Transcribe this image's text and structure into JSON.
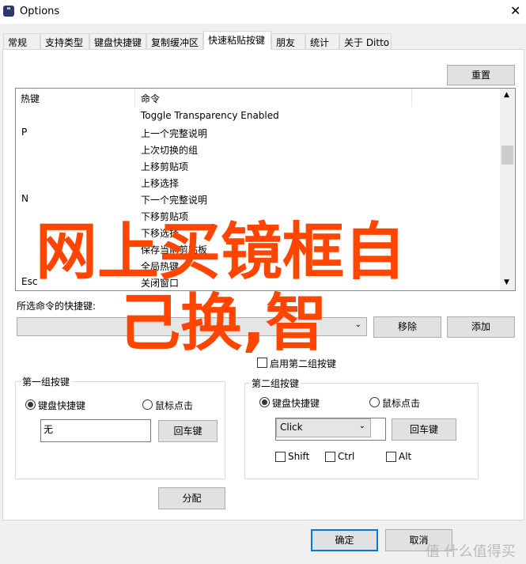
{
  "window": {
    "title": "Options",
    "close": "✕",
    "icon": "ditto-app-icon"
  },
  "tabs": [
    {
      "label": "常规"
    },
    {
      "label": "支持类型"
    },
    {
      "label": "键盘快捷键"
    },
    {
      "label": "复制缓冲区"
    },
    {
      "label": "快速粘贴按键",
      "active": true
    },
    {
      "label": "朋友"
    },
    {
      "label": "统计"
    },
    {
      "label": "关于 Ditto"
    }
  ],
  "reset_label": "重置",
  "list": {
    "headers": [
      "热键",
      "命令"
    ],
    "rows": [
      {
        "key": "",
        "cmd": "Toggle Transparency Enabled"
      },
      {
        "key": "P",
        "cmd": "上一个完整说明"
      },
      {
        "key": "",
        "cmd": "上次切换的组"
      },
      {
        "key": "",
        "cmd": "上移剪贴项"
      },
      {
        "key": "",
        "cmd": "上移选择"
      },
      {
        "key": "N",
        "cmd": "下一个完整说明"
      },
      {
        "key": "",
        "cmd": "下移剪贴项"
      },
      {
        "key": "",
        "cmd": "下移选择"
      },
      {
        "key": "",
        "cmd": "保存当前剪贴板"
      },
      {
        "key": "",
        "cmd": "全局热键"
      },
      {
        "key": "Esc",
        "cmd": "关闭窗口"
      }
    ]
  },
  "selected_label": "所选命令的快捷键:",
  "remove_label": "移除",
  "add_label": "添加",
  "enable_second_label": "启用第二组按键",
  "group1": {
    "title": "第一组按键",
    "radio_keyboard": "键盘快捷键",
    "radio_mouse": "鼠标点击",
    "value": "无",
    "enter_label": "回车键"
  },
  "group2": {
    "title": "第二组按键",
    "radio_keyboard": "键盘快捷键",
    "radio_mouse": "鼠标点击",
    "select_value": "Click",
    "enter_label": "回车键",
    "shift": "Shift",
    "ctrl": "Ctrl",
    "alt": "Alt"
  },
  "assign_label": "分配",
  "ok_label": "确定",
  "cancel_label": "取消",
  "overlay": {
    "line1": "网上买镜框自",
    "line2": "己换,智",
    "color": "#ff4500"
  },
  "watermark": "值 什么值得买"
}
